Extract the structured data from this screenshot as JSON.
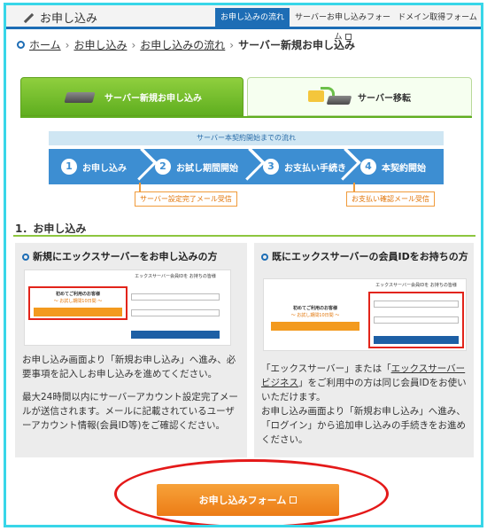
{
  "topnav": {
    "title": "お申し込み",
    "tabs": [
      {
        "label": "お申し込みの流れ",
        "active": true
      },
      {
        "label": "サーバーお申し込みフォーム",
        "external": true
      },
      {
        "label": "ドメイン取得フォーム"
      }
    ]
  },
  "breadcrumb": {
    "items": [
      "ホーム",
      "お申し込み",
      "お申し込みの流れ"
    ],
    "current": "サーバー新規お申し込み"
  },
  "choices": {
    "new_label": "サーバー新規お申し込み",
    "move_label": "サーバー移転"
  },
  "flow": {
    "heading": "サーバー本契約開始までの流れ",
    "steps": [
      {
        "num": "1",
        "label": "お申し込み"
      },
      {
        "num": "2",
        "label": "お試し期間開始"
      },
      {
        "num": "3",
        "label": "お支払い手続き"
      },
      {
        "num": "4",
        "label": "本契約開始"
      }
    ],
    "note_left": "サーバー設定完了メール受信",
    "note_right": "お支払い確認メール受信"
  },
  "section": {
    "title": "1．お申し込み"
  },
  "left_panel": {
    "title": "新規にエックスサーバーをお申し込みの方",
    "shot": {
      "heading": "エックスサーバー会員IDを お持ちの皆様",
      "new_heading": "初めてご利用のお客様",
      "new_sub": "〜 お試し期間10日間 〜",
      "new_button": "10日間無料お試し 新規お申込み",
      "login_button": "ログイン"
    },
    "p1": "お申し込み画面より「新規お申し込み」へ進み、必要事項を記入しお申し込みを進めてください。",
    "p2": "最大24時間以内にサーバーアカウント設定完了メールが送信されます。メールに記載されているユーザーアカウント情報(会員ID等)をご確認ください。"
  },
  "right_panel": {
    "title": "既にエックスサーバーの会員IDをお持ちの方",
    "shot": {
      "heading": "エックスサーバー会員IDを お持ちの皆様",
      "new_heading": "初めてご利用のお客様",
      "new_sub": "〜 お試し期間10日間 〜",
      "new_button": "10日間無料お試し 新規お申込み",
      "login_button": "ログイン"
    },
    "p1_pre": "「エックスサーバー」または「",
    "p1_link": "エックスサーバービジネス",
    "p1_post": "」をご利用中の方は同じ会員IDをお使いいただけます。",
    "p2": "お申し込み画面より「新規お申し込み」へ進み、「ログイン」から追加申し込みの手続きをお進めください。"
  },
  "form_button": {
    "label": "お申し込みフォーム"
  },
  "colors": {
    "accent_blue": "#1d6db5",
    "flow_blue": "#3d8ed2",
    "green": "#5fae1f",
    "orange": "#ec7c16",
    "annotation_red": "#e41919",
    "frame_cyan": "#38d6e8"
  }
}
